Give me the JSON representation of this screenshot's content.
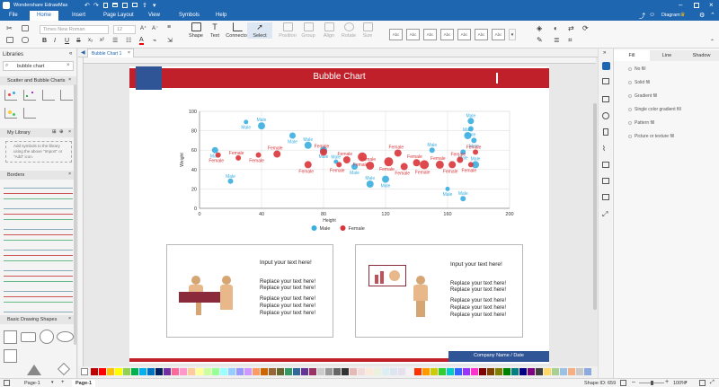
{
  "app": {
    "title": "Wondershare EdrawMax"
  },
  "menu": {
    "items": [
      "File",
      "Home",
      "Insert",
      "Page Layout",
      "View",
      "Symbols",
      "Help"
    ],
    "active": "Home",
    "user": "Diagram"
  },
  "ribbon": {
    "font_family": "Times New Roman",
    "font_size": "12",
    "tools": [
      {
        "label": "Shape",
        "enabled": true
      },
      {
        "label": "Text",
        "enabled": true
      },
      {
        "label": "Connector",
        "enabled": true
      },
      {
        "label": "Select",
        "enabled": true
      },
      {
        "label": "Position",
        "enabled": false
      },
      {
        "label": "Group",
        "enabled": false
      },
      {
        "label": "Align",
        "enabled": false
      },
      {
        "label": "Rotate",
        "enabled": false
      },
      {
        "label": "Size",
        "enabled": false
      }
    ],
    "style_samples": [
      "Abc",
      "Abc",
      "Abc",
      "Abc",
      "Abc",
      "Abc",
      "Abc"
    ]
  },
  "left_panel": {
    "title": "Libraries",
    "search_value": "bubble chart",
    "sections": [
      {
        "title": "Scatter and Bubble Charts"
      },
      {
        "title": "My Library",
        "hint": "Add symbols to the library using the above \"Import\" or \"Add\" icon."
      },
      {
        "title": "Borders"
      },
      {
        "title": "Basic Drawing Shapes"
      }
    ]
  },
  "document_tab": {
    "label": "Bubble Chart 1"
  },
  "slide": {
    "title": "Bubble Chart",
    "card1": {
      "heading": "Input your text here!",
      "lines": [
        "Replace your text here!",
        "Replace your text here!",
        "Replace your text here!",
        "Replace your text here!",
        "Replace your text here!"
      ]
    },
    "card2": {
      "heading": "Input your text here!",
      "lines": [
        "Replace your text here!",
        "Replace your text here!",
        "Replace your text here!",
        "Replace your text here!",
        "Replace your text here!"
      ]
    },
    "footer": "Company Name / Date"
  },
  "chart_data": {
    "type": "scatter",
    "xlabel": "Height",
    "ylabel": "Weight",
    "xlim": [
      0,
      200
    ],
    "ylim": [
      0,
      100
    ],
    "xticks": [
      0,
      40,
      80,
      120,
      160,
      200
    ],
    "yticks": [
      0,
      20,
      40,
      60,
      80,
      100
    ],
    "grid": true,
    "legend_position": "bottom",
    "series": [
      {
        "name": "Male",
        "color": "#3aaee0",
        "points": [
          {
            "x": 10,
            "y": 60,
            "r": 3.5
          },
          {
            "x": 20,
            "y": 28,
            "r": 3
          },
          {
            "x": 30,
            "y": 89,
            "r": 2.5
          },
          {
            "x": 40,
            "y": 85,
            "r": 4
          },
          {
            "x": 60,
            "y": 75,
            "r": 3.5
          },
          {
            "x": 70,
            "y": 65,
            "r": 4
          },
          {
            "x": 80,
            "y": 60,
            "r": 4
          },
          {
            "x": 88,
            "y": 48,
            "r": 2.5
          },
          {
            "x": 100,
            "y": 43,
            "r": 3.5
          },
          {
            "x": 110,
            "y": 25,
            "r": 4
          },
          {
            "x": 120,
            "y": 30,
            "r": 4
          },
          {
            "x": 150,
            "y": 60,
            "r": 3
          },
          {
            "x": 160,
            "y": 20,
            "r": 2.5
          },
          {
            "x": 170,
            "y": 10,
            "r": 3
          },
          {
            "x": 170,
            "y": 58,
            "r": 3
          },
          {
            "x": 173,
            "y": 75,
            "r": 4
          },
          {
            "x": 175,
            "y": 82,
            "r": 3
          },
          {
            "x": 175,
            "y": 90,
            "r": 3.5
          },
          {
            "x": 177,
            "y": 70,
            "r": 3
          },
          {
            "x": 178,
            "y": 45,
            "r": 4
          }
        ]
      },
      {
        "name": "Female",
        "color": "#d9353a",
        "points": [
          {
            "x": 12,
            "y": 55,
            "r": 3
          },
          {
            "x": 25,
            "y": 52,
            "r": 3
          },
          {
            "x": 38,
            "y": 55,
            "r": 3
          },
          {
            "x": 50,
            "y": 56,
            "r": 4
          },
          {
            "x": 70,
            "y": 45,
            "r": 4
          },
          {
            "x": 80,
            "y": 58,
            "r": 4
          },
          {
            "x": 90,
            "y": 45,
            "r": 3
          },
          {
            "x": 95,
            "y": 50,
            "r": 4
          },
          {
            "x": 105,
            "y": 53,
            "r": 5
          },
          {
            "x": 110,
            "y": 44,
            "r": 4.5
          },
          {
            "x": 122,
            "y": 48,
            "r": 5
          },
          {
            "x": 128,
            "y": 57,
            "r": 4
          },
          {
            "x": 132,
            "y": 43,
            "r": 4
          },
          {
            "x": 140,
            "y": 47,
            "r": 4
          },
          {
            "x": 145,
            "y": 45,
            "r": 5
          },
          {
            "x": 155,
            "y": 45,
            "r": 4.5
          },
          {
            "x": 163,
            "y": 45,
            "r": 4
          },
          {
            "x": 168,
            "y": 50,
            "r": 3.5
          },
          {
            "x": 175,
            "y": 45,
            "r": 3
          },
          {
            "x": 178,
            "y": 58,
            "r": 3
          }
        ]
      }
    ]
  },
  "right_panel": {
    "tabs": [
      "Fill",
      "Line",
      "Shadow"
    ],
    "active_tab": "Fill",
    "options": [
      "No fill",
      "Solid fill",
      "Gradient fill",
      "Single color gradient fill",
      "Pattern fill",
      "Picture or texture fill"
    ]
  },
  "status": {
    "page_tab_1": "Page-1",
    "page_tab_2": "Page-1",
    "shape_id": "Shape ID: 659",
    "zoom": "100%"
  },
  "palette_colors": [
    "#c00000",
    "#ff0000",
    "#ffc000",
    "#ffff00",
    "#92d050",
    "#00b050",
    "#00b0f0",
    "#0070c0",
    "#002060",
    "#7030a0",
    "#ff6699",
    "#ff99cc",
    "#ffcc99",
    "#ffff99",
    "#ccff99",
    "#99ff99",
    "#99ffff",
    "#99ccff",
    "#9999ff",
    "#cc99ff",
    "#ff9966",
    "#cc6600",
    "#996633",
    "#666633",
    "#339966",
    "#336699",
    "#663399",
    "#993366",
    "#cccccc",
    "#999999",
    "#666666",
    "#333333",
    "#e6b8b7",
    "#f2dcdb",
    "#fde9d9",
    "#ebf1dd",
    "#dbeef3",
    "#dce6f1",
    "#e5e0ec",
    "#f2f2f2",
    "#ff3300",
    "#ff9900",
    "#cccc00",
    "#33cc33",
    "#00cccc",
    "#3366ff",
    "#9933ff",
    "#ff33cc",
    "#800000",
    "#804000",
    "#808000",
    "#008000",
    "#008080",
    "#000080",
    "#800080",
    "#404040",
    "#ffd966",
    "#a9d08e",
    "#9bc2e6",
    "#f4b084",
    "#c9c9c9",
    "#8ea9db"
  ]
}
